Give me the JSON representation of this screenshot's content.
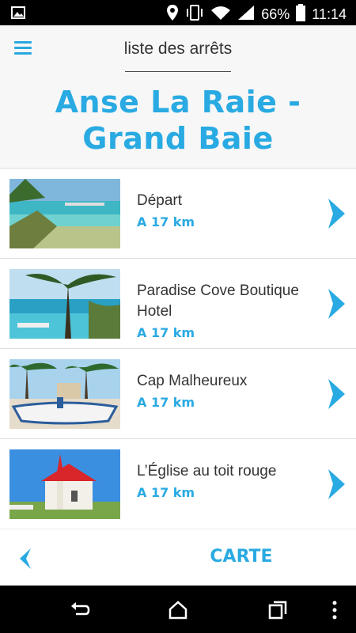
{
  "status_bar": {
    "battery_percent": "66%",
    "time": "11:14",
    "icons": [
      "image-icon",
      "location-icon",
      "vibrate-icon",
      "wifi-icon",
      "signal-icon",
      "battery-icon"
    ]
  },
  "header": {
    "screen_title": "liste des arrêts",
    "route_title": "Anse La Raie - Grand Baie",
    "menu_icon": "hamburger-menu-icon",
    "accent_color": "#29aae2"
  },
  "stops": [
    {
      "name": "Départ",
      "distance": "A 17 km",
      "thumb": "beach-lagoon-photo"
    },
    {
      "name": "Paradise Cove Boutique Hotel",
      "distance": "A 17 km",
      "thumb": "infinity-pool-palm-photo"
    },
    {
      "name": "Cap Malheureux",
      "distance": "A 17 km",
      "thumb": "fishing-boat-beach-photo"
    },
    {
      "name": "L’Église au toit rouge",
      "distance": "A 17 km",
      "thumb": "red-roof-church-photo"
    }
  ],
  "bottom_bar": {
    "back_icon": "chevron-left-icon",
    "map_button_label": "CARTE"
  },
  "nav_bar": {
    "icons": [
      "back-nav-icon",
      "home-nav-icon",
      "recents-nav-icon",
      "more-nav-icon"
    ]
  }
}
